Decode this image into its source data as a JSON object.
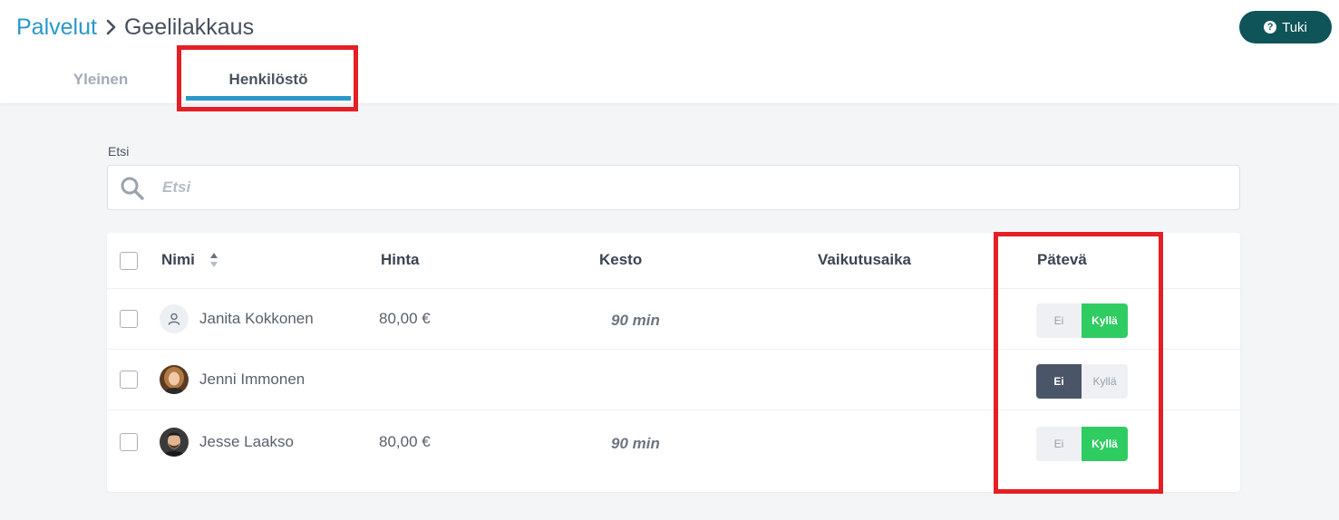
{
  "breadcrumb": {
    "parent": "Palvelut",
    "current": "Geelilakkaus"
  },
  "help": {
    "label": "Tuki"
  },
  "tabs": {
    "general": "Yleinen",
    "staff": "Henkilöstö"
  },
  "search": {
    "label": "Etsi",
    "placeholder": "Etsi"
  },
  "table": {
    "columns": {
      "name": "Nimi",
      "price": "Hinta",
      "duration": "Kesto",
      "effect_time": "Vaikutusaika",
      "qualified": "Pätevä"
    },
    "toggle": {
      "no": "Ei",
      "yes": "Kyllä"
    },
    "rows": [
      {
        "name": "Janita Kokkonen",
        "price": "80,00 €",
        "duration": "90 min",
        "effect_time": "",
        "qualified": "yes"
      },
      {
        "name": "Jenni Immonen",
        "price": "",
        "duration": "",
        "effect_time": "",
        "qualified": "no"
      },
      {
        "name": "Jesse Laakso",
        "price": "80,00 €",
        "duration": "90 min",
        "effect_time": "",
        "qualified": "yes"
      }
    ]
  },
  "colors": {
    "accent": "#2a98c9",
    "help_button": "#0f5458",
    "toggle_yes": "#2fcc62",
    "toggle_no": "#4a5568",
    "highlight": "#e51f26"
  }
}
